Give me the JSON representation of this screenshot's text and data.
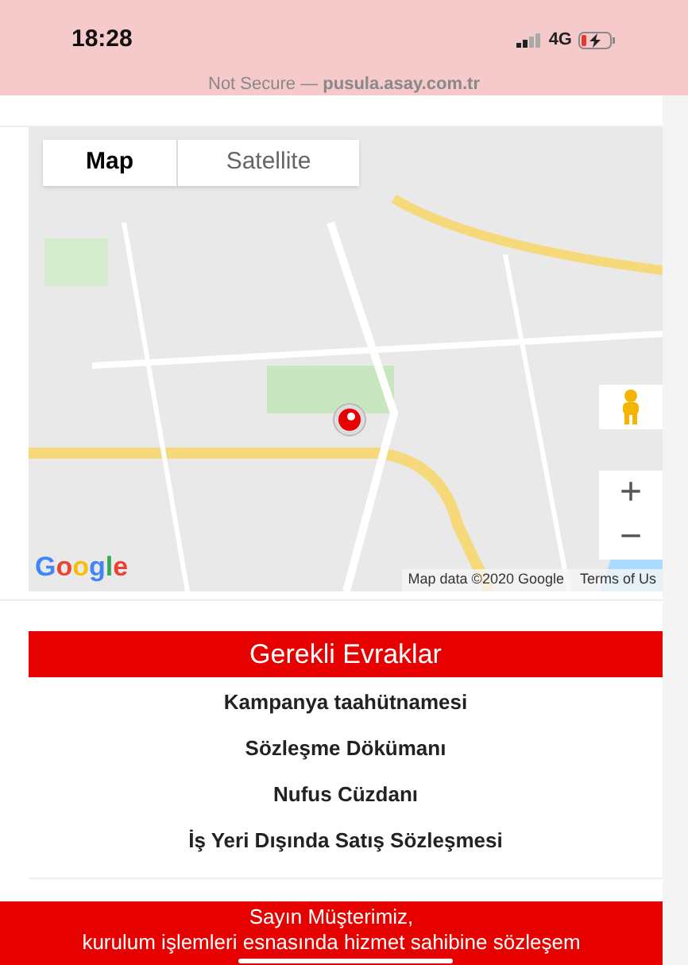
{
  "status_bar": {
    "time": "18:28",
    "network": "4G",
    "charging": true
  },
  "address_bar": {
    "text": "Not Secure — **pusula.asay.com.tr**"
  },
  "map": {
    "map_types": [
      {
        "label": "Map",
        "selected": true
      },
      {
        "label": "Satellite",
        "selected": false
      }
    ],
    "zoom_in": "+",
    "zoom_out": "−",
    "logo": "Google",
    "attribution": "Map data ©2020 Google",
    "terms": "Terms of Us"
  },
  "documents": {
    "title": "Gerekli Evraklar",
    "items": [
      "Kampanya taahütnamesi",
      "Sözleşme Dökümanı",
      "Nufus Cüzdanı",
      "İş Yeri Dışında Satış Sözleşmesi"
    ]
  },
  "notice": {
    "lines": [
      "Sayın Müşterimiz,",
      "kurulum işlemleri esnasında hizmet sahibine sözleşem"
    ]
  }
}
